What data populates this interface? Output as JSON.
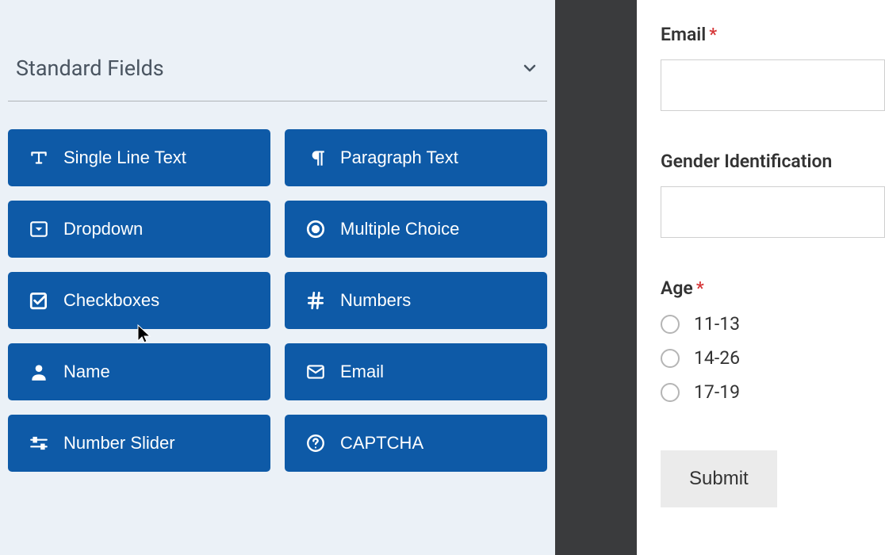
{
  "sidebar": {
    "section_title": "Standard Fields",
    "fields": [
      {
        "label": "Single Line Text",
        "icon": "text-icon"
      },
      {
        "label": "Paragraph Text",
        "icon": "paragraph-icon"
      },
      {
        "label": "Dropdown",
        "icon": "dropdown-icon"
      },
      {
        "label": "Multiple Choice",
        "icon": "multiple-choice-icon"
      },
      {
        "label": "Checkboxes",
        "icon": "checkboxes-icon"
      },
      {
        "label": "Numbers",
        "icon": "numbers-icon"
      },
      {
        "label": "Name",
        "icon": "name-icon"
      },
      {
        "label": "Email",
        "icon": "email-icon"
      },
      {
        "label": "Number Slider",
        "icon": "slider-icon"
      },
      {
        "label": "CAPTCHA",
        "icon": "captcha-icon"
      }
    ]
  },
  "form": {
    "email": {
      "label": "Email",
      "value": "",
      "required": true
    },
    "gender": {
      "label": "Gender Identification",
      "value": "",
      "required": false
    },
    "age": {
      "label": "Age",
      "required": true,
      "options": [
        "11-13",
        "14-26",
        "17-19"
      ]
    },
    "submit_label": "Submit"
  },
  "colors": {
    "accent": "#0e5aa7",
    "panel_bg": "#ebf1f7",
    "required": "#d63638"
  }
}
